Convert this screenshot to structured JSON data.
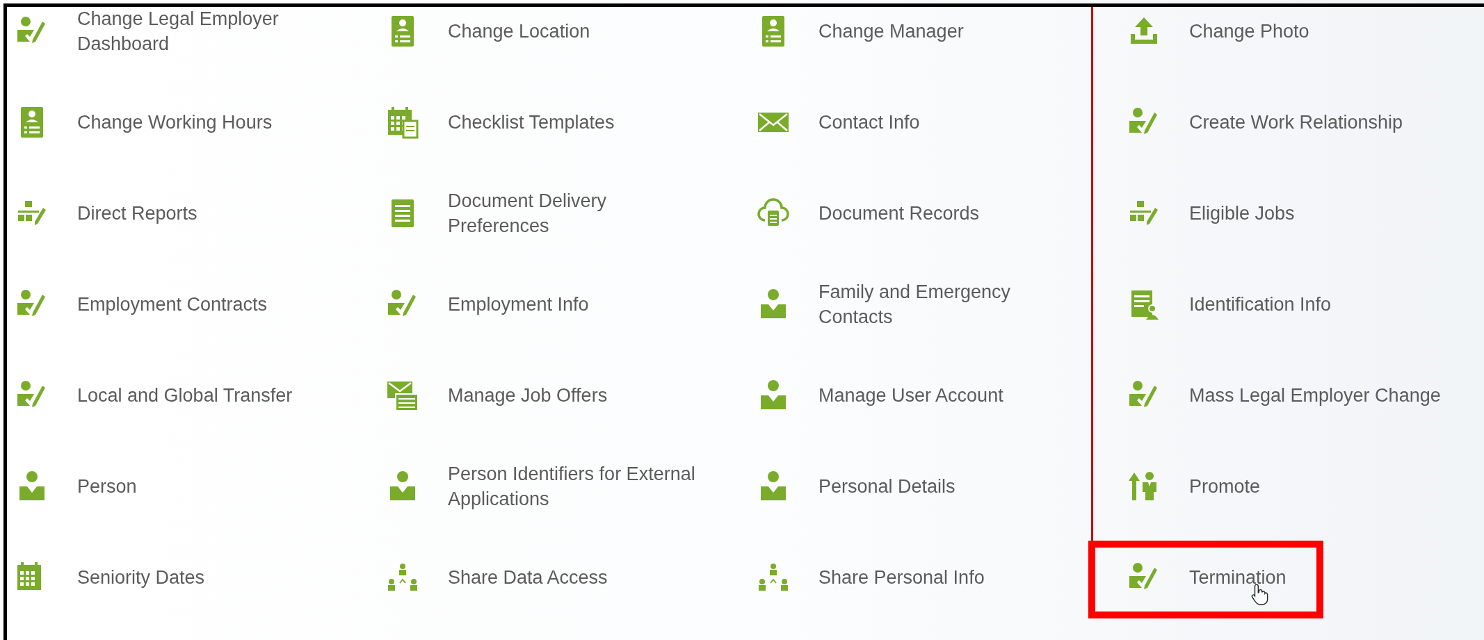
{
  "items": [
    {
      "label": "Change Legal Employer\nDashboard",
      "kind": "person-edit",
      "highlighted": false,
      "pointer": false
    },
    {
      "label": "Change Location",
      "kind": "badge",
      "highlighted": false,
      "pointer": false
    },
    {
      "label": "Change Manager",
      "kind": "badge",
      "highlighted": false,
      "pointer": false
    },
    {
      "label": "Change Photo",
      "kind": "upload",
      "highlighted": false,
      "pointer": false
    },
    {
      "label": "Change Working Hours",
      "kind": "badge",
      "highlighted": false,
      "pointer": false
    },
    {
      "label": "Checklist Templates",
      "kind": "calendar-doc",
      "highlighted": false,
      "pointer": false
    },
    {
      "label": "Contact Info",
      "kind": "envelope",
      "highlighted": false,
      "pointer": false
    },
    {
      "label": "Create Work Relationship",
      "kind": "person-edit",
      "highlighted": false,
      "pointer": false
    },
    {
      "label": "Direct Reports",
      "kind": "org-edit",
      "highlighted": false,
      "pointer": false
    },
    {
      "label": "Document Delivery\nPreferences",
      "kind": "document",
      "highlighted": false,
      "pointer": false
    },
    {
      "label": "Document Records",
      "kind": "cloud-doc",
      "highlighted": false,
      "pointer": false
    },
    {
      "label": "Eligible Jobs",
      "kind": "org-edit",
      "highlighted": false,
      "pointer": false
    },
    {
      "label": "Employment Contracts",
      "kind": "person-edit",
      "highlighted": false,
      "pointer": false
    },
    {
      "label": "Employment Info",
      "kind": "person-edit",
      "highlighted": false,
      "pointer": false
    },
    {
      "label": "Family and Emergency\nContacts",
      "kind": "person",
      "highlighted": false,
      "pointer": false
    },
    {
      "label": "Identification Info",
      "kind": "id-doc",
      "highlighted": false,
      "pointer": false
    },
    {
      "label": "Local and Global Transfer",
      "kind": "person-edit",
      "highlighted": false,
      "pointer": false
    },
    {
      "label": "Manage Job Offers",
      "kind": "envelope-doc",
      "highlighted": false,
      "pointer": false
    },
    {
      "label": "Manage User Account",
      "kind": "person",
      "highlighted": false,
      "pointer": false
    },
    {
      "label": "Mass Legal Employer Change",
      "kind": "person-edit",
      "highlighted": false,
      "pointer": false
    },
    {
      "label": "Person",
      "kind": "person",
      "highlighted": false,
      "pointer": false
    },
    {
      "label": "Person Identifiers for External\nApplications",
      "kind": "person",
      "highlighted": false,
      "pointer": false
    },
    {
      "label": "Personal Details",
      "kind": "person",
      "highlighted": false,
      "pointer": false
    },
    {
      "label": "Promote",
      "kind": "promote",
      "highlighted": false,
      "pointer": false
    },
    {
      "label": "Seniority Dates",
      "kind": "calendar",
      "highlighted": false,
      "pointer": false
    },
    {
      "label": "Share Data Access",
      "kind": "share",
      "highlighted": false,
      "pointer": false
    },
    {
      "label": "Share Personal Info",
      "kind": "share",
      "highlighted": false,
      "pointer": false
    },
    {
      "label": "Termination",
      "kind": "person-edit",
      "highlighted": true,
      "pointer": true
    }
  ]
}
